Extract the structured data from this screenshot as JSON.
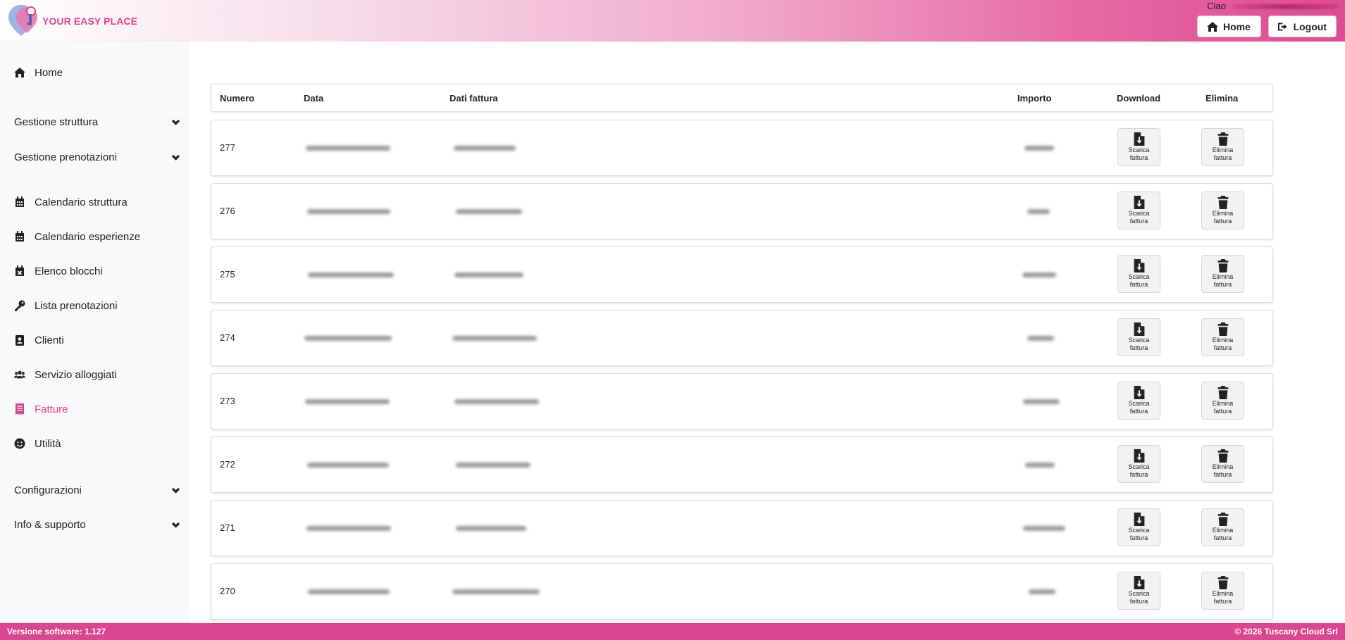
{
  "header": {
    "brand": "YOUR EASY PLACE",
    "greeting": "Ciao",
    "home_label": "Home",
    "logout_label": "Logout"
  },
  "sidebar": {
    "home": "Home",
    "groups": {
      "gestione_struttura": "Gestione struttura",
      "gestione_prenotazioni": "Gestione prenotazioni",
      "configurazioni": "Configurazioni",
      "info_supporto": "Info & supporto"
    },
    "items": [
      {
        "label": "Calendario struttura",
        "icon": "calendar-icon"
      },
      {
        "label": "Calendario esperienze",
        "icon": "calendar-icon"
      },
      {
        "label": "Elenco blocchi",
        "icon": "calendar-x-icon"
      },
      {
        "label": "Lista prenotazioni",
        "icon": "key-icon"
      },
      {
        "label": "Clienti",
        "icon": "contact-icon"
      },
      {
        "label": "Servizio alloggiati",
        "icon": "users-icon"
      },
      {
        "label": "Fatture",
        "icon": "receipt-icon",
        "active": true
      },
      {
        "label": "Utilità",
        "icon": "smile-icon"
      }
    ],
    "accent_color": "#d94391"
  },
  "table": {
    "headers": {
      "numero": "Numero",
      "data": "Data",
      "dati_fattura": "Dati fattura",
      "importo": "Importo",
      "download": "Download",
      "elimina": "Elimina"
    },
    "download_label_1": "Scarica",
    "download_label_2": "fattura",
    "delete_label_1": "Elimina",
    "delete_label_2": "fattura",
    "rows": [
      {
        "numero": "277"
      },
      {
        "numero": "276"
      },
      {
        "numero": "275"
      },
      {
        "numero": "274"
      },
      {
        "numero": "273"
      },
      {
        "numero": "272"
      },
      {
        "numero": "271"
      },
      {
        "numero": "270"
      }
    ]
  },
  "footer": {
    "version_label": "Versione software:",
    "version": "1.127",
    "copyright": "© 2026 Tuscany Cloud Srl",
    "color": "#dc4591"
  }
}
